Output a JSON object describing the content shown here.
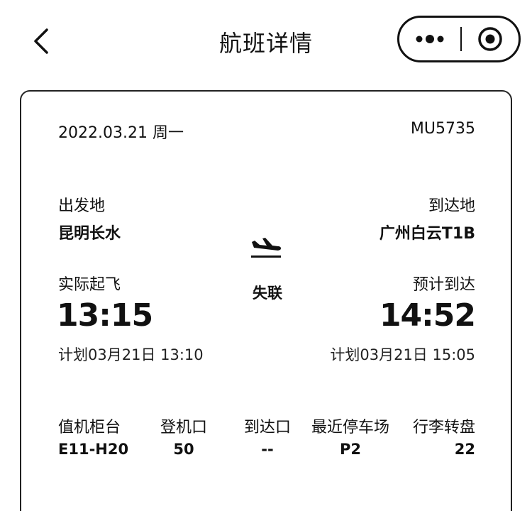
{
  "header": {
    "title": "航班详情"
  },
  "flight": {
    "date": "2022.03.21 周一",
    "number": "MU5735",
    "departure": {
      "label": "出发地",
      "city": "昆明长水",
      "time_label": "实际起飞",
      "time": "13:15",
      "plan": "计划03月21日 13:10"
    },
    "arrival": {
      "label": "到达地",
      "city": "广州白云T1B",
      "time_label": "预计到达",
      "time": "14:52",
      "plan": "计划03月21日 15:05"
    },
    "status": "失联"
  },
  "info": {
    "headers": [
      "值机柜台",
      "登机口",
      "到达口",
      "最近停车场",
      "行李转盘"
    ],
    "values": [
      "E11-H20",
      "50",
      "--",
      "P2",
      "22"
    ]
  },
  "icons": {
    "back": "chevron-left-icon",
    "more": "more-dots-icon",
    "close": "target-circle-icon",
    "plane": "plane-landing-icon"
  }
}
